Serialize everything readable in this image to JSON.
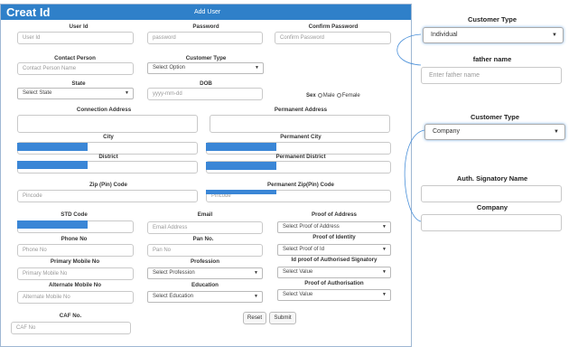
{
  "app_title": "Creat Id",
  "form_title": "Add User",
  "fields": {
    "user_id": {
      "label": "User Id",
      "placeholder": "User Id"
    },
    "password": {
      "label": "Password",
      "placeholder": "password"
    },
    "confirm_password": {
      "label": "Confirm Password",
      "placeholder": "Confirm Password"
    },
    "contact_person": {
      "label": "Contact Person",
      "placeholder": "Contact Person Name"
    },
    "customer_type": {
      "label": "Customer Type",
      "value": "Select Option"
    },
    "state": {
      "label": "State",
      "value": "Select State"
    },
    "dob": {
      "label": "DOB",
      "placeholder": "yyyy-mm-dd"
    },
    "sex": {
      "label": "Sex",
      "options": [
        "Male",
        "Female"
      ]
    },
    "connection_address": {
      "label": "Connection Address"
    },
    "permanent_address": {
      "label": "Permanent Address"
    },
    "city": {
      "label": "City"
    },
    "permanent_city": {
      "label": "Permanent City"
    },
    "district": {
      "label": "District"
    },
    "permanent_district": {
      "label": "Permanent District"
    },
    "zip": {
      "label": "Zip (Pin) Code",
      "placeholder": "Pincode"
    },
    "permanent_zip": {
      "label": "Permanent Zip(Pin) Code",
      "placeholder": "Pincode"
    },
    "std_code": {
      "label": "STD Code"
    },
    "email": {
      "label": "Email",
      "placeholder": "Email Address"
    },
    "proof_of_address": {
      "label": "Proof of Address",
      "value": "Select Proof of Address"
    },
    "phone_no": {
      "label": "Phone No",
      "placeholder": "Phone No"
    },
    "pan_no": {
      "label": "Pan No.",
      "placeholder": "Pan No"
    },
    "proof_of_identity": {
      "label": "Proof of Identity",
      "value": "Select Proof of Id"
    },
    "primary_mobile": {
      "label": "Primary Mobile No",
      "placeholder": "Primary  Mobile No"
    },
    "profession": {
      "label": "Profession",
      "value": "Select Profession"
    },
    "id_proof_auth_signatory": {
      "label": "Id proof of Authorised Signatory",
      "value": "Select Value"
    },
    "alternate_mobile": {
      "label": "Alternate Mobile No",
      "placeholder": "Alternate Mobile No"
    },
    "education": {
      "label": "Education",
      "value": "Select Education"
    },
    "proof_of_authorisation": {
      "label": "Proof of Authorisation",
      "value": "Select Value"
    },
    "caf_no": {
      "label": "CAF No.",
      "placeholder": "CAF No"
    }
  },
  "buttons": {
    "reset": "Reset",
    "submit": "Submit"
  },
  "side": {
    "customer_type_1": {
      "label": "Customer Type",
      "value": "Individual"
    },
    "father_name": {
      "label": "father name",
      "placeholder": "Enter father name"
    },
    "customer_type_2": {
      "label": "Customer Type",
      "value": "Company"
    },
    "auth_signatory": {
      "label": "Auth. Signatory Name"
    },
    "company": {
      "label": "Company"
    }
  },
  "icons": {
    "caret": "caret-down-icon"
  },
  "colors": {
    "title_bar": "#2f80c9",
    "redaction": "#3a86d6",
    "focus_glow": "#7fb2e6"
  }
}
